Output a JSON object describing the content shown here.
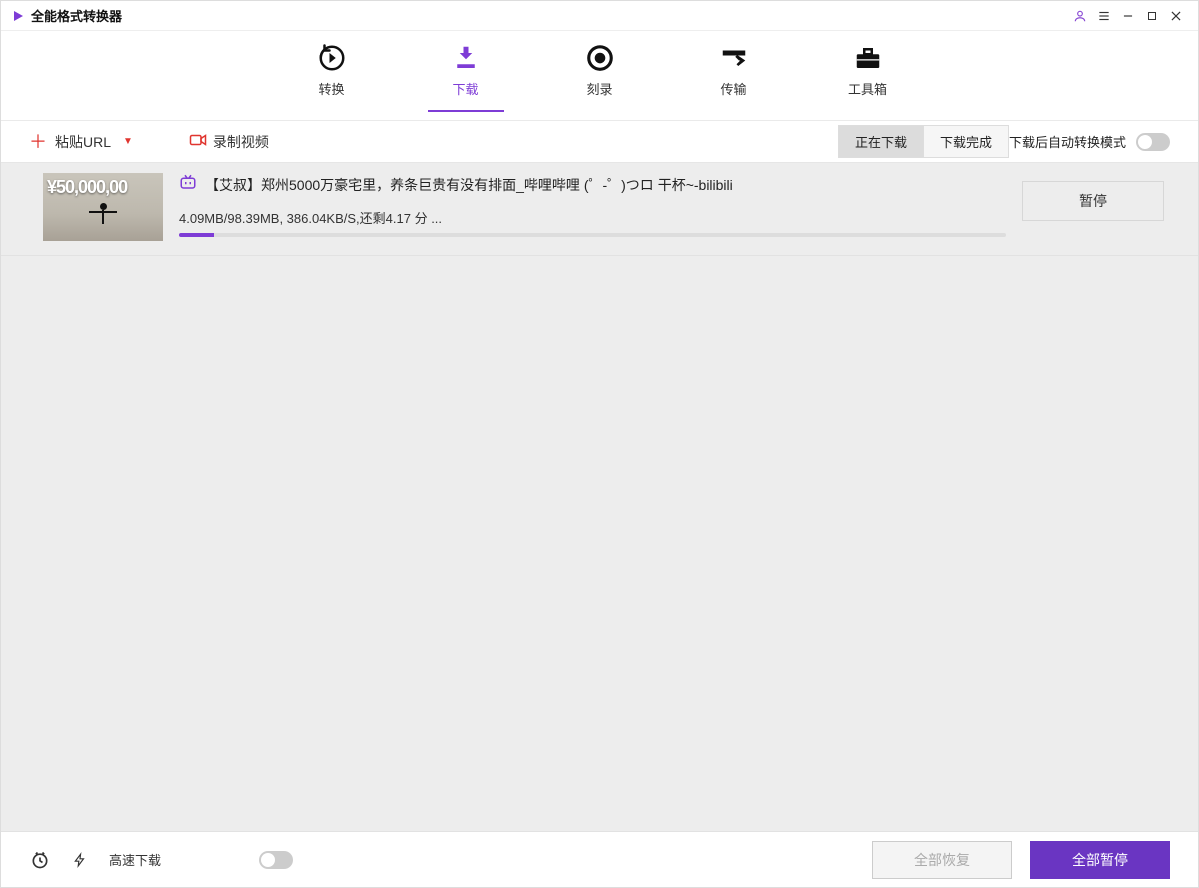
{
  "app": {
    "title": "全能格式转换器"
  },
  "nav": {
    "convert": "转换",
    "download": "下载",
    "burn": "刻录",
    "transfer": "传输",
    "toolbox": "工具箱"
  },
  "toolbar": {
    "paste_url": "粘贴URL",
    "record_video": "录制视频",
    "subtab_downloading": "正在下载",
    "subtab_done": "下载完成",
    "auto_convert": "下载后自动转换模式"
  },
  "downloads": [
    {
      "thumb_overlay": "¥50,000,00",
      "title": "【艾叔】郑州5000万豪宅里，养条巨贵有没有排面_哔哩哔哩 (゜-゜)つロ 干杯~-bilibili",
      "status": "4.09MB/98.39MB, 386.04KB/S,还剩4.17 分 ...",
      "progress_pct": 4.2,
      "pause_label": "暂停"
    }
  ],
  "bottom": {
    "fast": "高速下载",
    "resume_all": "全部恢复",
    "pause_all": "全部暂停"
  }
}
